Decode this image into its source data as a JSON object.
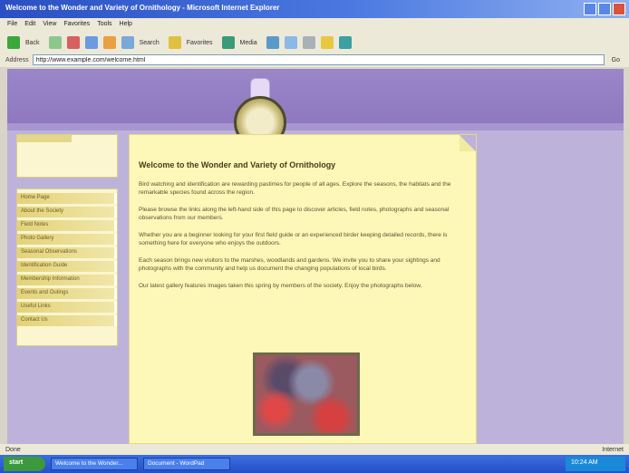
{
  "window": {
    "title": "Welcome to the Wonder and Variety of Ornithology - Microsoft Internet Explorer"
  },
  "menu": {
    "items": [
      "File",
      "Edit",
      "View",
      "Favorites",
      "Tools",
      "Help"
    ]
  },
  "toolbar": {
    "back": "Back",
    "search": "Search",
    "favorites": "Favorites",
    "media": "Media"
  },
  "address": {
    "label": "Address",
    "value": "http://www.example.com/welcome.html",
    "go": "Go"
  },
  "page": {
    "heading": "Welcome to the Wonder and Variety of Ornithology",
    "paragraphs": [
      "Bird watching and identification are rewarding pastimes for people of all ages. Explore the seasons, the habitats and the remarkable species found across the region.",
      "Please browse the links along the left-hand side of this page to discover articles, field notes, photographs and seasonal observations from our members.",
      "Whether you are a beginner looking for your first field guide or an experienced birder keeping detailed records, there is something here for everyone who enjoys the outdoors.",
      "Each season brings new visitors to the marshes, woodlands and gardens. We invite you to share your sightings and photographs with the community and help us document the changing populations of local birds.",
      "Our latest gallery features images taken this spring by members of the society. Enjoy the photographs below."
    ]
  },
  "sidebar": {
    "nav": [
      "Home Page",
      "About the Society",
      "Field Notes",
      "Photo Gallery",
      "Seasonal Observations",
      "Identification Guide",
      "Membership Information",
      "Events and Outings",
      "Useful Links",
      "Contact Us"
    ]
  },
  "status": {
    "text": "Done",
    "zone": "Internet"
  },
  "taskbar": {
    "start": "start",
    "items": [
      "Welcome to the Wonder...",
      "Document - WordPad"
    ],
    "clock": "10:24 AM"
  }
}
